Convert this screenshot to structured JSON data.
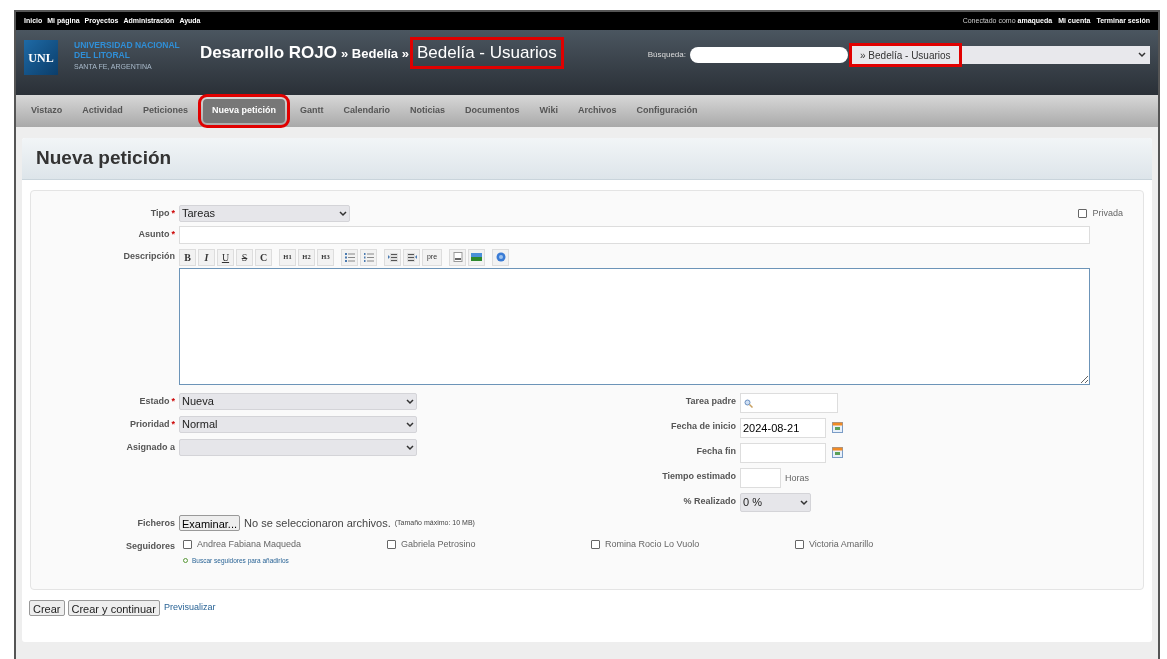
{
  "top_menu": [
    "Inicio",
    "Mi página",
    "Proyectos",
    "Administración",
    "Ayuda"
  ],
  "account": {
    "prefix": "Conectado como",
    "user": "amaqueda",
    "links": [
      "Mi cuenta",
      "Terminar sesión"
    ]
  },
  "logo": {
    "mark": "UNL",
    "lines": [
      "UNIVERSIDAD NACIONAL",
      "DEL LITORAL"
    ],
    "place": "SANTA FE, ARGENTINA"
  },
  "title": {
    "project": "Desarrollo ROJO",
    "separator": "» Bedelía »",
    "current": "Bedelía - Usuarios",
    "highlighted": true
  },
  "search": {
    "label": "Búsqueda:"
  },
  "project_jump": {
    "value": "» Bedelía - Usuarios",
    "highlighted": true
  },
  "tabs": [
    {
      "label": "Vistazo",
      "selected": false
    },
    {
      "label": "Actividad",
      "selected": false
    },
    {
      "label": "Peticiones",
      "selected": false
    },
    {
      "label": "Nueva petición",
      "selected": true
    },
    {
      "label": "Gantt",
      "selected": false
    },
    {
      "label": "Calendario",
      "selected": false
    },
    {
      "label": "Noticias",
      "selected": false
    },
    {
      "label": "Documentos",
      "selected": false
    },
    {
      "label": "Wiki",
      "selected": false
    },
    {
      "label": "Archivos",
      "selected": false
    },
    {
      "label": "Configuración",
      "selected": false
    }
  ],
  "heading": "Nueva petición",
  "tipo": {
    "label": "Tipo",
    "required": "*",
    "value": "Tareas"
  },
  "privada": {
    "label": "Privada",
    "checked": false
  },
  "asunto": {
    "label": "Asunto",
    "required": "*"
  },
  "descripcion": {
    "label": "Descripción",
    "toolbar": [
      {
        "kind": "bold",
        "label": "B"
      },
      {
        "kind": "italic",
        "label": "I"
      },
      {
        "kind": "underline",
        "label": "U"
      },
      {
        "kind": "strike",
        "label": "S"
      },
      {
        "kind": "code",
        "label": "C"
      },
      {
        "kind": "heading",
        "label": "H1"
      },
      {
        "kind": "heading",
        "label": "H2"
      },
      {
        "kind": "heading",
        "label": "H3"
      },
      {
        "kind": "bullets"
      },
      {
        "kind": "numbers"
      },
      {
        "kind": "indent"
      },
      {
        "kind": "outdent"
      },
      {
        "kind": "pre",
        "label": "pre"
      },
      {
        "kind": "link"
      },
      {
        "kind": "image"
      },
      {
        "kind": "help"
      }
    ]
  },
  "left_fields": [
    {
      "label": "Estado",
      "required": "*",
      "value": "Nueva"
    },
    {
      "label": "Prioridad",
      "required": "*",
      "value": "Normal"
    },
    {
      "label": "Asignado a"
    }
  ],
  "right_fields": [
    {
      "kind": "search",
      "label": "Tarea padre"
    },
    {
      "kind": "date",
      "label": "Fecha de inicio",
      "value": "2024-08-21"
    },
    {
      "kind": "date",
      "label": "Fecha fin"
    },
    {
      "kind": "hours",
      "label": "Tiempo estimado",
      "unit": "Horas"
    },
    {
      "kind": "select",
      "label": "% Realizado",
      "value": "0 %"
    }
  ],
  "ficheros": {
    "label": "Ficheros",
    "button": "Examinar...",
    "status": "No se seleccionaron archivos.",
    "note": "(Tamaño máximo: 10 MB)"
  },
  "seguidores": {
    "label": "Seguidores",
    "people": [
      {
        "name": "Andrea Fabiana Maqueda",
        "checked": false
      },
      {
        "name": "Gabriela Petrosino",
        "checked": false
      },
      {
        "name": "Romina Rocio Lo Vuolo",
        "checked": false
      },
      {
        "name": "Victoria Amarillo",
        "checked": false
      }
    ],
    "search_link": "Buscar seguidores para añadirlos"
  },
  "buttons": [
    "Crear",
    "Crear y continuar"
  ],
  "preview_link": "Previsualizar"
}
